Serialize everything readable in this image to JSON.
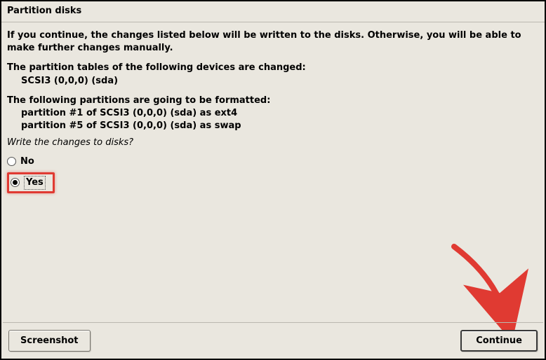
{
  "title": "Partition disks",
  "intro": "If you continue, the changes listed below will be written to the disks. Otherwise, you will be able to make further changes manually.",
  "tables_header": "The partition tables of the following devices are changed:",
  "tables_items": [
    "SCSI3 (0,0,0) (sda)"
  ],
  "format_header": "The following partitions are going to be formatted:",
  "format_items": [
    "partition #1 of SCSI3 (0,0,0) (sda) as ext4",
    "partition #5 of SCSI3 (0,0,0) (sda) as swap"
  ],
  "prompt": "Write the changes to disks?",
  "options": {
    "no": "No",
    "yes": "Yes",
    "selected": "yes"
  },
  "buttons": {
    "screenshot": "Screenshot",
    "continue": "Continue"
  },
  "annotation": {
    "highlight_color": "#e03a32",
    "arrow_color": "#e03a32"
  }
}
